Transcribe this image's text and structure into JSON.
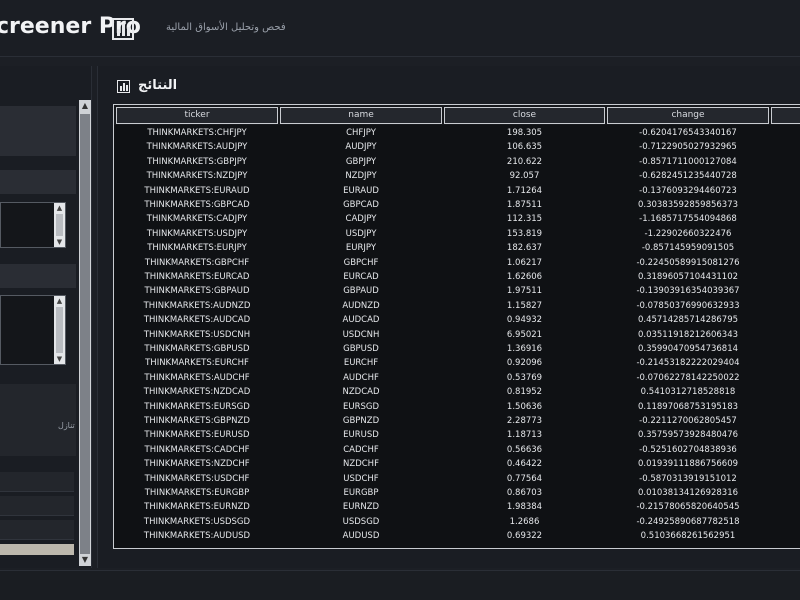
{
  "app": {
    "title": "creener Pro",
    "subtitle": "فحص وتحليل الأسواق المالية",
    "chart_icon": "bar-chart-icon"
  },
  "left_panel": {
    "partial_label": "تنازل"
  },
  "results": {
    "title": "النتائج",
    "icon": "bar-chart-icon",
    "columns": [
      "ticker",
      "name",
      "close",
      "change",
      ""
    ],
    "rows": [
      [
        "THINKMARKETS:CHFJPY",
        "CHFJPY",
        "198.305",
        "-0.6204176543340167"
      ],
      [
        "THINKMARKETS:AUDJPY",
        "AUDJPY",
        "106.635",
        "-0.7122905027932965"
      ],
      [
        "THINKMARKETS:GBPJPY",
        "GBPJPY",
        "210.622",
        "-0.8571711000127084"
      ],
      [
        "THINKMARKETS:NZDJPY",
        "NZDJPY",
        "92.057",
        "-0.6282451235440728"
      ],
      [
        "THINKMARKETS:EURAUD",
        "EURAUD",
        "1.71264",
        "-0.1376093294460723"
      ],
      [
        "THINKMARKETS:GBPCAD",
        "GBPCAD",
        "1.87511",
        "0.30383592859856373"
      ],
      [
        "THINKMARKETS:CADJPY",
        "CADJPY",
        "112.315",
        "-1.1685717554094868"
      ],
      [
        "THINKMARKETS:USDJPY",
        "USDJPY",
        "153.819",
        "-1.22902660322476"
      ],
      [
        "THINKMARKETS:EURJPY",
        "EURJPY",
        "182.637",
        "-0.857145959091505"
      ],
      [
        "THINKMARKETS:GBPCHF",
        "GBPCHF",
        "1.06217",
        "-0.22450589915081276"
      ],
      [
        "THINKMARKETS:EURCAD",
        "EURCAD",
        "1.62606",
        "0.31896057104431102"
      ],
      [
        "THINKMARKETS:GBPAUD",
        "GBPAUD",
        "1.97511",
        "-0.13903916354039367"
      ],
      [
        "THINKMARKETS:AUDNZD",
        "AUDNZD",
        "1.15827",
        "-0.07850376990632933"
      ],
      [
        "THINKMARKETS:AUDCAD",
        "AUDCAD",
        "0.94932",
        "0.45714285714286795"
      ],
      [
        "THINKMARKETS:USDCNH",
        "USDCNH",
        "6.95021",
        "0.03511918212606343"
      ],
      [
        "THINKMARKETS:GBPUSD",
        "GBPUSD",
        "1.36916",
        "0.35990470954736814"
      ],
      [
        "THINKMARKETS:EURCHF",
        "EURCHF",
        "0.92096",
        "-0.21453182222029404"
      ],
      [
        "THINKMARKETS:AUDCHF",
        "AUDCHF",
        "0.53769",
        "-0.07062278142250022"
      ],
      [
        "THINKMARKETS:NZDCAD",
        "NZDCAD",
        "0.81952",
        "0.5410312718528818"
      ],
      [
        "THINKMARKETS:EURSGD",
        "EURSGD",
        "1.50636",
        "0.11897068753195183"
      ],
      [
        "THINKMARKETS:GBPNZD",
        "GBPNZD",
        "2.28773",
        "-0.2211270062805457"
      ],
      [
        "THINKMARKETS:EURUSD",
        "EURUSD",
        "1.18713",
        "0.35759573928480476"
      ],
      [
        "THINKMARKETS:CADCHF",
        "CADCHF",
        "0.56636",
        "-0.5251602704838936"
      ],
      [
        "THINKMARKETS:NZDCHF",
        "NZDCHF",
        "0.46422",
        "0.01939111886756609"
      ],
      [
        "THINKMARKETS:USDCHF",
        "USDCHF",
        "0.77564",
        "-0.5870313919151012"
      ],
      [
        "THINKMARKETS:EURGBP",
        "EURGBP",
        "0.86703",
        "0.01038134126928316"
      ],
      [
        "THINKMARKETS:EURNZD",
        "EURNZD",
        "1.98384",
        "-0.21578065820640545"
      ],
      [
        "THINKMARKETS:USDSGD",
        "USDSGD",
        "1.2686",
        "-0.24925890687782518"
      ],
      [
        "THINKMARKETS:AUDUSD",
        "AUDUSD",
        "0.69322",
        "0.5103668261562951"
      ]
    ]
  },
  "colors": {
    "background": "#1c1f25",
    "panel": "#1a1d23",
    "table_border": "#c9ccd1"
  }
}
